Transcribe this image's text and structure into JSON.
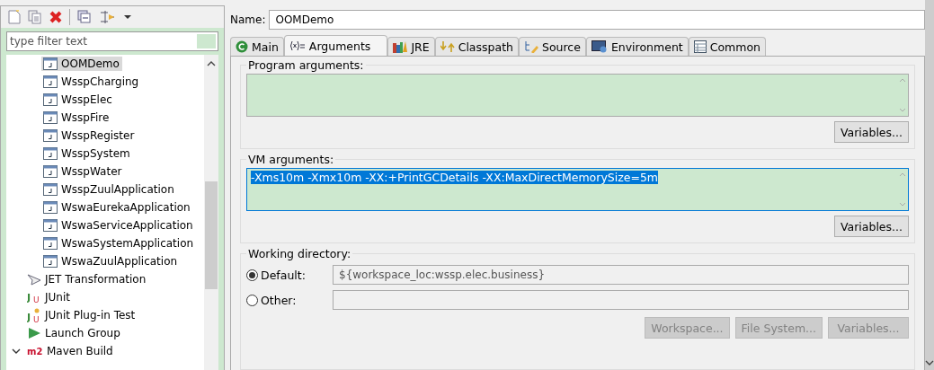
{
  "filter": {
    "placeholder": "type filter text"
  },
  "tree": [
    {
      "children": [
        {
          "label": "OOMDemo",
          "kind": "java",
          "selected": true
        },
        {
          "label": "WsspCharging",
          "kind": "java",
          "selected": false
        },
        {
          "label": "WsspElec",
          "kind": "java",
          "selected": false
        },
        {
          "label": "WsspFire",
          "kind": "java",
          "selected": false
        },
        {
          "label": "WsspRegister",
          "kind": "java",
          "selected": false
        },
        {
          "label": "WsspSystem",
          "kind": "java",
          "selected": false
        },
        {
          "label": "WsspWater",
          "kind": "java",
          "selected": false
        },
        {
          "label": "WsspZuulApplication",
          "kind": "java",
          "selected": false
        },
        {
          "label": "WswaEurekaApplication",
          "kind": "java",
          "selected": false
        },
        {
          "label": "WswaServiceApplication",
          "kind": "java",
          "selected": false
        },
        {
          "label": "WswaSystemApplication",
          "kind": "java",
          "selected": false
        },
        {
          "label": "WswaZuulApplication",
          "kind": "java",
          "selected": false
        }
      ]
    },
    {
      "label": "JET Transformation",
      "kind": "jet",
      "selected": false
    },
    {
      "label": "JUnit",
      "kind": "junit",
      "selected": false,
      "icon_letters": [
        "J",
        "U"
      ]
    },
    {
      "label": "JUnit Plug-in Test",
      "kind": "junit-plugin",
      "selected": false,
      "icon_letters": [
        "J",
        "U"
      ]
    },
    {
      "label": "Launch Group",
      "kind": "launch-group",
      "selected": false
    },
    {
      "label": "Maven Build",
      "kind": "maven",
      "selected": false,
      "icon_letters": [
        "m2"
      ],
      "expanded": true
    }
  ],
  "name": {
    "label": "Name:",
    "value": "OOMDemo"
  },
  "tabs": [
    {
      "label": "Main",
      "kind": "main",
      "selected": false
    },
    {
      "label": "Arguments",
      "kind": "arguments",
      "selected": true
    },
    {
      "label": "JRE",
      "kind": "jre",
      "selected": false
    },
    {
      "label": "Classpath",
      "kind": "classpath",
      "selected": false
    },
    {
      "label": "Source",
      "kind": "source",
      "selected": false
    },
    {
      "label": "Environment",
      "kind": "environment",
      "selected": false
    },
    {
      "label": "Common",
      "kind": "common",
      "selected": false
    }
  ],
  "program_arguments": {
    "label": "Program arguments:",
    "button": "Variables..."
  },
  "vm_arguments": {
    "label": "VM arguments:",
    "value": "-Xms10m -Xmx10m -XX:+PrintGCDetails -XX:MaxDirectMemorySize=5m",
    "button": "Variables..."
  },
  "working_directory": {
    "label": "Working directory:",
    "options": [
      {
        "label": "Default:",
        "selected": true,
        "value": "${workspace_loc:wssp.elec.business}"
      },
      {
        "label": "Other:",
        "selected": false
      }
    ],
    "buttons": [
      {
        "label": "Workspace...",
        "disabled": true
      },
      {
        "label": "File System...",
        "disabled": true
      },
      {
        "label": "Variables...",
        "disabled": true
      }
    ]
  }
}
